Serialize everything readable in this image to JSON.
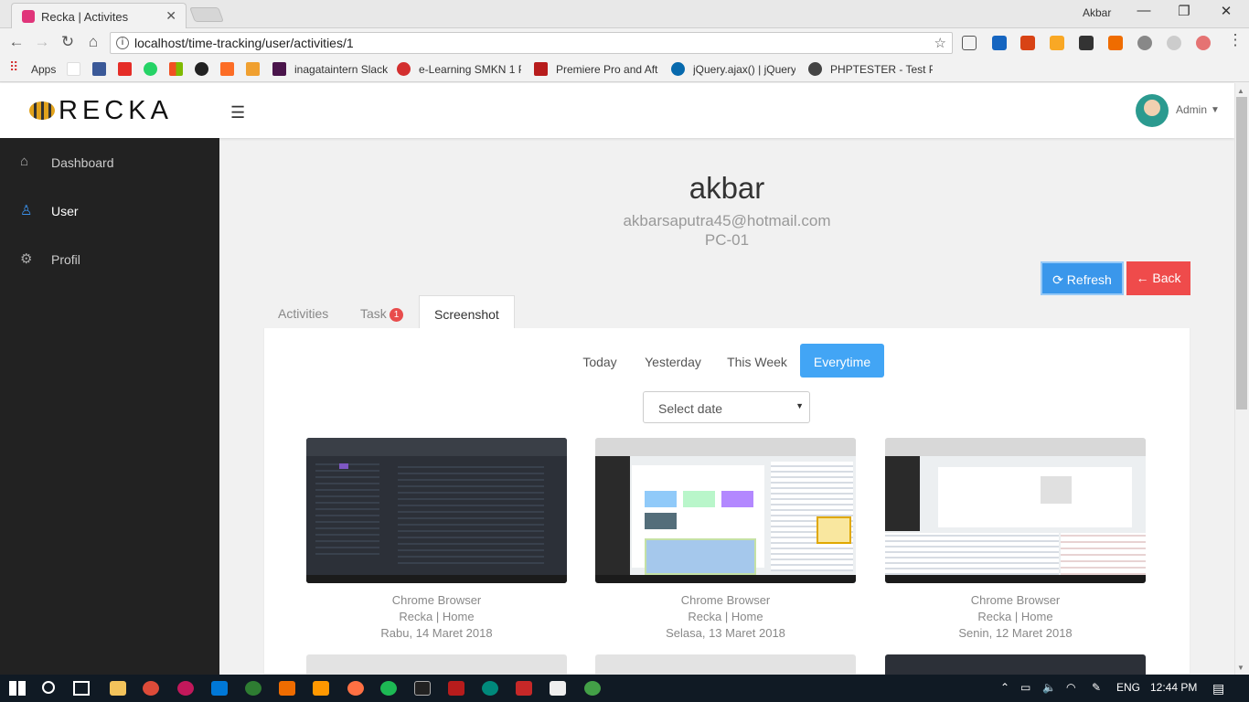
{
  "browser": {
    "tab_title": "Recka | Activites",
    "window_user": "Akbar",
    "url": "localhost/time-tracking/user/activities/1",
    "bookmarks": [
      "Apps",
      "inagataintern Slack",
      "e-Learning SMKN 1 P",
      "Premiere Pro and Aft",
      "jQuery.ajax() | jQuery",
      "PHPTESTER - Test PH"
    ]
  },
  "header": {
    "logo": "RECKA",
    "user": "Admin"
  },
  "sidebar": {
    "items": [
      {
        "label": "Dashboard",
        "icon": "home-icon"
      },
      {
        "label": "User",
        "icon": "user-icon"
      },
      {
        "label": "Profil",
        "icon": "gear-icon"
      }
    ]
  },
  "profile": {
    "name": "akbar",
    "email": "akbarsaputra45@hotmail.com",
    "pc": "PC-01"
  },
  "actions": {
    "refresh": "Refresh",
    "back": "Back"
  },
  "tabs": {
    "activities": "Activities",
    "task": "Task",
    "task_badge": "1",
    "screenshot": "Screenshot"
  },
  "filters": [
    "Today",
    "Yesterday",
    "This Week",
    "Everytime"
  ],
  "date_select": {
    "placeholder": "Select date"
  },
  "screenshots": [
    {
      "app": "Chrome Browser",
      "title": "Recka | Home",
      "date": "Rabu, 14 Maret 2018"
    },
    {
      "app": "Chrome Browser",
      "title": "Recka | Home",
      "date": "Selasa, 13 Maret 2018"
    },
    {
      "app": "Chrome Browser",
      "title": "Recka | Home",
      "date": "Senin, 12 Maret 2018"
    }
  ],
  "taskbar": {
    "lang": "ENG",
    "time": "12:44 PM"
  }
}
